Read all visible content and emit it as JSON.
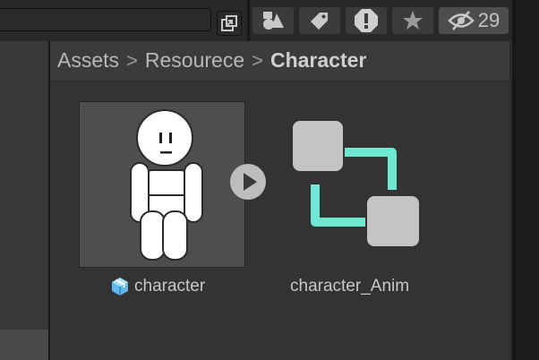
{
  "toolbar": {
    "search": {
      "value": ""
    },
    "hidden_count": "29",
    "icons": [
      "popout-icon",
      "shapes-icon",
      "label-tag-icon",
      "warning-icon",
      "star-icon",
      "eye-slash-icon"
    ]
  },
  "breadcrumb": {
    "items": [
      "Assets",
      "Resourece",
      "Character"
    ],
    "separator": ">"
  },
  "assets": [
    {
      "name": "character",
      "type": "prefab",
      "icon": "prefab-cube-icon"
    },
    {
      "name": "character_Anim",
      "type": "animator-controller",
      "icon": "animator-controller-icon"
    }
  ],
  "colors": {
    "accent_teal": "#6ee8d3",
    "prefab_blue": "#5fb8f0",
    "node_gray": "#c4c4c4"
  }
}
